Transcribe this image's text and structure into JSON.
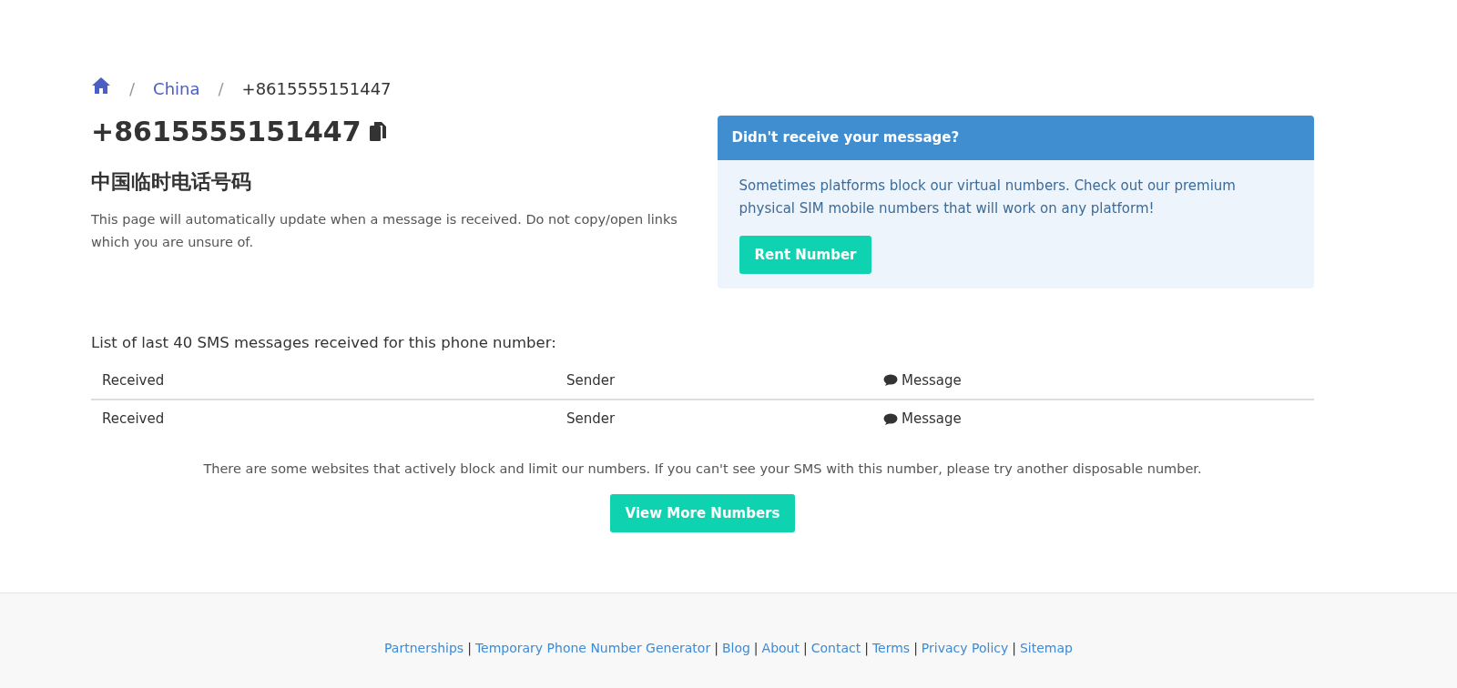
{
  "breadcrumb": {
    "separator": "/",
    "items": [
      {
        "kind": "home"
      },
      {
        "kind": "link",
        "label": "China"
      },
      {
        "kind": "current",
        "label": "+8615555151447"
      }
    ]
  },
  "number_title": "+8615555151447",
  "subtitle": "中国临时电话号码",
  "intro": "This page will automatically update when a message is received. Do not copy/open links which you are unsure of.",
  "notice": {
    "title": "Didn't receive your message?",
    "text": "Sometimes platforms block our virtual numbers. Check out our premium physical SIM mobile numbers that will work on any platform!",
    "button": "Rent Number"
  },
  "list_heading": "List of last 40 SMS messages received for this phone number:",
  "table": {
    "columns": [
      {
        "label": "Received"
      },
      {
        "label": "Sender"
      },
      {
        "label": "Message",
        "icon": true
      }
    ],
    "footer_columns": [
      {
        "label": "Received"
      },
      {
        "label": "Sender"
      },
      {
        "label": "Message",
        "icon": true
      }
    ]
  },
  "blocking_note": "There are some websites that actively block and limit our numbers. If you can't see your SMS with this number, please try another disposable number.",
  "more_button": "View More Numbers",
  "footer": {
    "separator": "|",
    "links": [
      "Partnerships",
      "Temporary Phone Number Generator",
      "Blog",
      "About",
      "Contact",
      "Terms",
      "Privacy Policy",
      "Sitemap"
    ]
  }
}
